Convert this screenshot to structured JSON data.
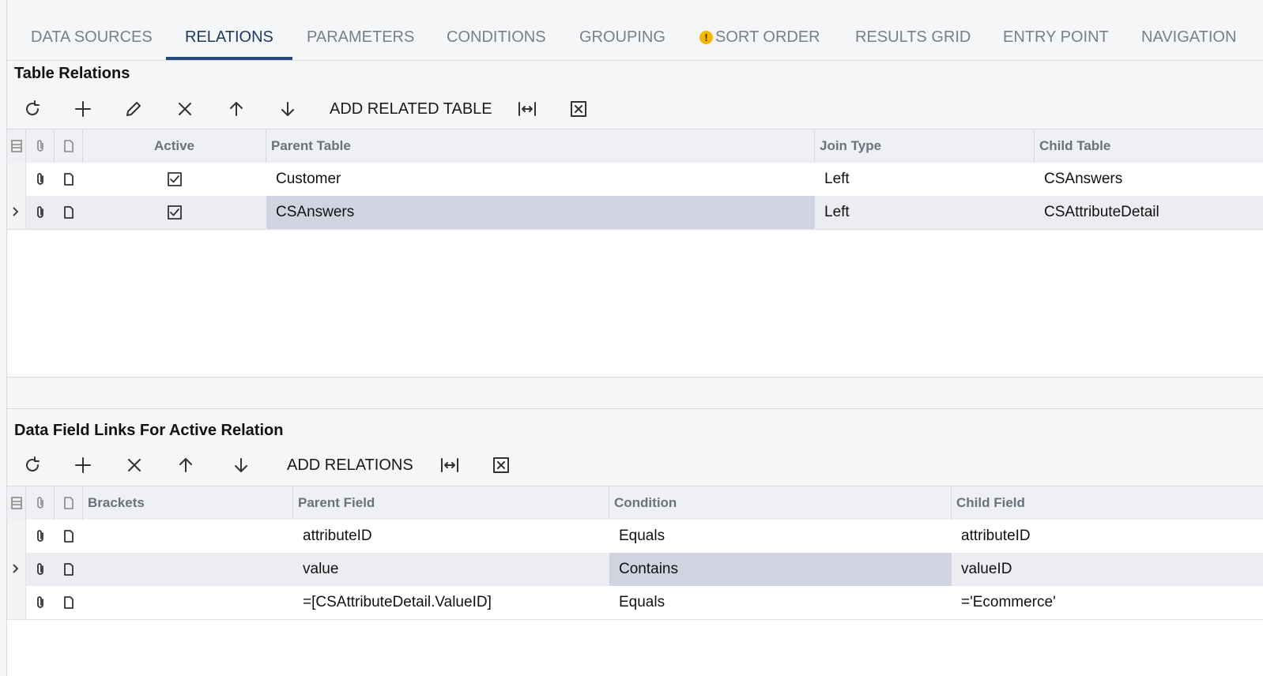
{
  "tabs": [
    {
      "label": "DATA SOURCES"
    },
    {
      "label": "RELATIONS"
    },
    {
      "label": "PARAMETERS"
    },
    {
      "label": "CONDITIONS"
    },
    {
      "label": "GROUPING"
    },
    {
      "label": "SORT ORDER"
    },
    {
      "label": "RESULTS GRID"
    },
    {
      "label": "ENTRY POINT"
    },
    {
      "label": "NAVIGATION"
    }
  ],
  "active_tab": "RELATIONS",
  "table_relations": {
    "title": "Table Relations",
    "toolbar": {
      "add_related_table_label": "ADD RELATED TABLE"
    },
    "columns": {
      "active": "Active",
      "parent_table": "Parent Table",
      "join_type": "Join Type",
      "child_table": "Child Table"
    },
    "rows": [
      {
        "active": true,
        "parent_table": "Customer",
        "join_type": "Left",
        "child_table": "CSAnswers"
      },
      {
        "active": true,
        "parent_table": "CSAnswers",
        "join_type": "Left",
        "child_table": "CSAttributeDetail"
      }
    ]
  },
  "data_field_links": {
    "title": "Data Field Links For Active Relation",
    "toolbar": {
      "add_relations_label": "ADD RELATIONS"
    },
    "columns": {
      "brackets": "Brackets",
      "parent_field": "Parent Field",
      "condition": "Condition",
      "child_field": "Child Field"
    },
    "rows": [
      {
        "brackets": "",
        "parent_field": "attributeID",
        "condition": "Equals",
        "child_field": "attributeID"
      },
      {
        "brackets": "",
        "parent_field": "value",
        "condition": "Contains",
        "child_field": "valueID"
      },
      {
        "brackets": "",
        "parent_field": "=[CSAttributeDetail.ValueID]",
        "condition": "Equals",
        "child_field": "='Ecommerce'"
      }
    ]
  },
  "colors": {
    "accent": "#284a76",
    "warning": "#f5b800",
    "selected_cell": "#d1d4e0"
  }
}
